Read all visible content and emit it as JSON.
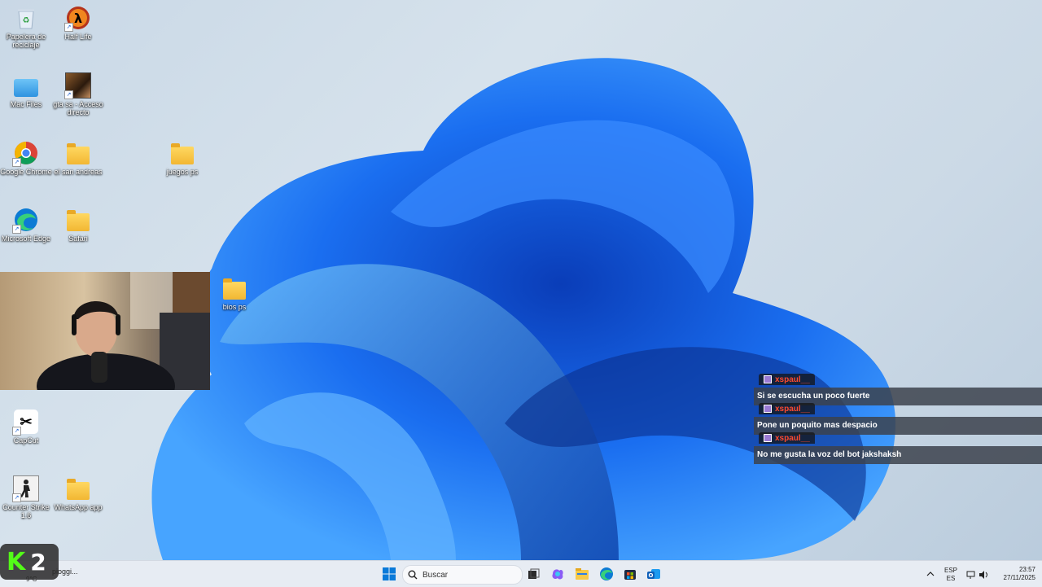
{
  "desktop": {
    "icons": [
      {
        "label": "Papelera de reciclaje"
      },
      {
        "label": "Half Life"
      },
      {
        "label": "Mac Files"
      },
      {
        "label": "gta sa - Acceso directo"
      },
      {
        "label": "Google Chrome"
      },
      {
        "label": "el san andreas"
      },
      {
        "label": "juegos ps"
      },
      {
        "label": "Microsoft Edge"
      },
      {
        "label": "Safari"
      },
      {
        "label": "bios ps"
      },
      {
        "label": "CapCut"
      },
      {
        "label": "Counter Strike 1.6"
      },
      {
        "label": "WhatsApp app"
      }
    ]
  },
  "chat": {
    "messages": [
      {
        "user": "xspaul__",
        "text": "Si se escucha un poco fuerte"
      },
      {
        "user": "xspaul__",
        "text": "Pone un poquito mas despacio"
      },
      {
        "user": "xspaul__",
        "text": "No me gusta la voz del bot jakshaksh"
      }
    ],
    "username_color": "#ff4a2e"
  },
  "stream_overlay": {
    "logo_text": "K",
    "logo_number": "2",
    "brand_color": "#53fc18"
  },
  "taskbar": {
    "weather": {
      "temp": "9°C",
      "text": "pioggi..."
    },
    "search_placeholder": "Buscar",
    "language": {
      "top": "ESP",
      "bottom": "ES"
    },
    "time": "23:57",
    "date": "27/11/2025"
  }
}
